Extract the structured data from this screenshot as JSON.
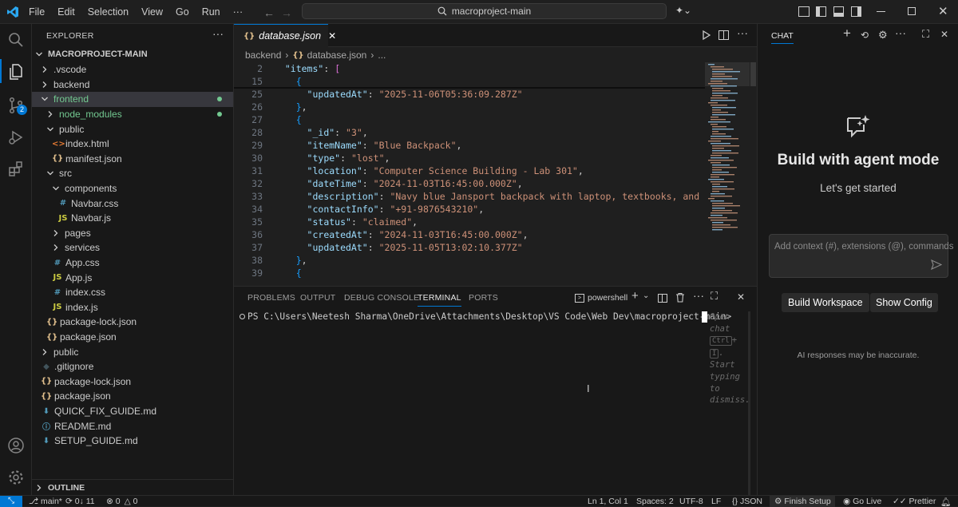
{
  "menu": [
    "File",
    "Edit",
    "Selection",
    "View",
    "Go",
    "Run",
    "···"
  ],
  "search": {
    "text": "macroproject-main"
  },
  "explorer": {
    "header": "EXPLORER",
    "root": "MACROPROJECT-MAIN",
    "items": [
      {
        "label": ".vscode",
        "kind": "folder",
        "depth": 1,
        "open": false
      },
      {
        "label": "backend",
        "kind": "folder",
        "depth": 1,
        "open": false
      },
      {
        "label": "frontend",
        "kind": "folder",
        "depth": 1,
        "open": true,
        "selected": true,
        "dot": true,
        "color": "#73c991"
      },
      {
        "label": "node_modules",
        "kind": "folder",
        "depth": 2,
        "open": false,
        "dot": true,
        "color": "#73c991"
      },
      {
        "label": "public",
        "kind": "folder",
        "depth": 2,
        "open": true
      },
      {
        "label": "index.html",
        "kind": "html",
        "depth": 3
      },
      {
        "label": "manifest.json",
        "kind": "json",
        "depth": 3
      },
      {
        "label": "src",
        "kind": "folder",
        "depth": 2,
        "open": true
      },
      {
        "label": "components",
        "kind": "folder",
        "depth": 3,
        "open": true
      },
      {
        "label": "Navbar.css",
        "kind": "css",
        "depth": 4
      },
      {
        "label": "Navbar.js",
        "kind": "js",
        "depth": 4
      },
      {
        "label": "pages",
        "kind": "folder",
        "depth": 3,
        "open": false
      },
      {
        "label": "services",
        "kind": "folder",
        "depth": 3,
        "open": false
      },
      {
        "label": "App.css",
        "kind": "css",
        "depth": 3
      },
      {
        "label": "App.js",
        "kind": "js",
        "depth": 3
      },
      {
        "label": "index.css",
        "kind": "css",
        "depth": 3
      },
      {
        "label": "index.js",
        "kind": "js",
        "depth": 3
      },
      {
        "label": "package-lock.json",
        "kind": "json",
        "depth": 2
      },
      {
        "label": "package.json",
        "kind": "json",
        "depth": 2
      },
      {
        "label": "public",
        "kind": "folder",
        "depth": 1,
        "open": false
      },
      {
        "label": ".gitignore",
        "kind": "git",
        "depth": 1
      },
      {
        "label": "package-lock.json",
        "kind": "json",
        "depth": 1
      },
      {
        "label": "package.json",
        "kind": "json",
        "depth": 1
      },
      {
        "label": "QUICK_FIX_GUIDE.md",
        "kind": "md",
        "depth": 1
      },
      {
        "label": "README.md",
        "kind": "info",
        "depth": 1
      },
      {
        "label": "SETUP_GUIDE.md",
        "kind": "md",
        "depth": 1
      }
    ],
    "outline": "OUTLINE"
  },
  "editor": {
    "tab": "database.json",
    "breadcrumb": [
      "backend",
      "database.json",
      "..."
    ],
    "lines": [
      {
        "n": "2",
        "code": "  \"items\": ["
      },
      {
        "n": "15",
        "code": "    {"
      },
      {
        "n": "25",
        "code": "      \"updatedAt\": \"2025-11-06T05:36:09.287Z\""
      },
      {
        "n": "26",
        "code": "    },"
      },
      {
        "n": "27",
        "code": "    {"
      },
      {
        "n": "28",
        "code": "      \"_id\": \"3\","
      },
      {
        "n": "29",
        "code": "      \"itemName\": \"Blue Backpack\","
      },
      {
        "n": "30",
        "code": "      \"type\": \"lost\","
      },
      {
        "n": "31",
        "code": "      \"location\": \"Computer Science Building - Lab 301\","
      },
      {
        "n": "32",
        "code": "      \"dateTime\": \"2024-11-03T16:45:00.000Z\","
      },
      {
        "n": "33",
        "code": "      \"description\": \"Navy blue Jansport backpack with laptop, textbooks, and impo"
      },
      {
        "n": "34",
        "code": "      \"contactInfo\": \"+91-9876543210\","
      },
      {
        "n": "35",
        "code": "      \"status\": \"claimed\","
      },
      {
        "n": "36",
        "code": "      \"createdAt\": \"2024-11-03T16:45:00.000Z\","
      },
      {
        "n": "37",
        "code": "      \"updatedAt\": \"2025-11-05T13:02:10.377Z\""
      },
      {
        "n": "38",
        "code": "    },"
      },
      {
        "n": "39",
        "code": "    {"
      }
    ]
  },
  "panel": {
    "tabs": [
      "PROBLEMS",
      "OUTPUT",
      "DEBUG CONSOLE",
      "TERMINAL",
      "PORTS"
    ],
    "active": "TERMINAL",
    "shell": "powershell",
    "prompt": "PS C:\\Users\\Neetesh Sharma\\OneDrive\\Attachments\\Desktop\\VS Code\\Web Dev\\macroproject-main>",
    "hint": [
      "Open",
      "chat",
      "Ctrl",
      "+",
      "I",
      "Start",
      "typing",
      "to",
      "dismiss."
    ]
  },
  "chat": {
    "header": "CHAT",
    "title": "Build with agent mode",
    "subtitle": "Let's get started",
    "placeholder": "Add context (#), extensions (@), commands",
    "btn1": "Build Workspace",
    "btn2": "Show Config",
    "disclaimer": "AI responses may be inaccurate."
  },
  "status": {
    "branch": "main*",
    "sync": "0↓ 11",
    "errors": "0",
    "warnings": "0",
    "position": "Ln 1, Col 1",
    "spaces": "Spaces: 2",
    "encoding": "UTF-8",
    "eol": "LF",
    "lang": "JSON",
    "setup": "Finish Setup",
    "golive": "Go Live",
    "prettier": "Prettier"
  },
  "colors": {
    "accent": "#0078d4",
    "badge": "#0078d4",
    "modified": "#73c991"
  }
}
